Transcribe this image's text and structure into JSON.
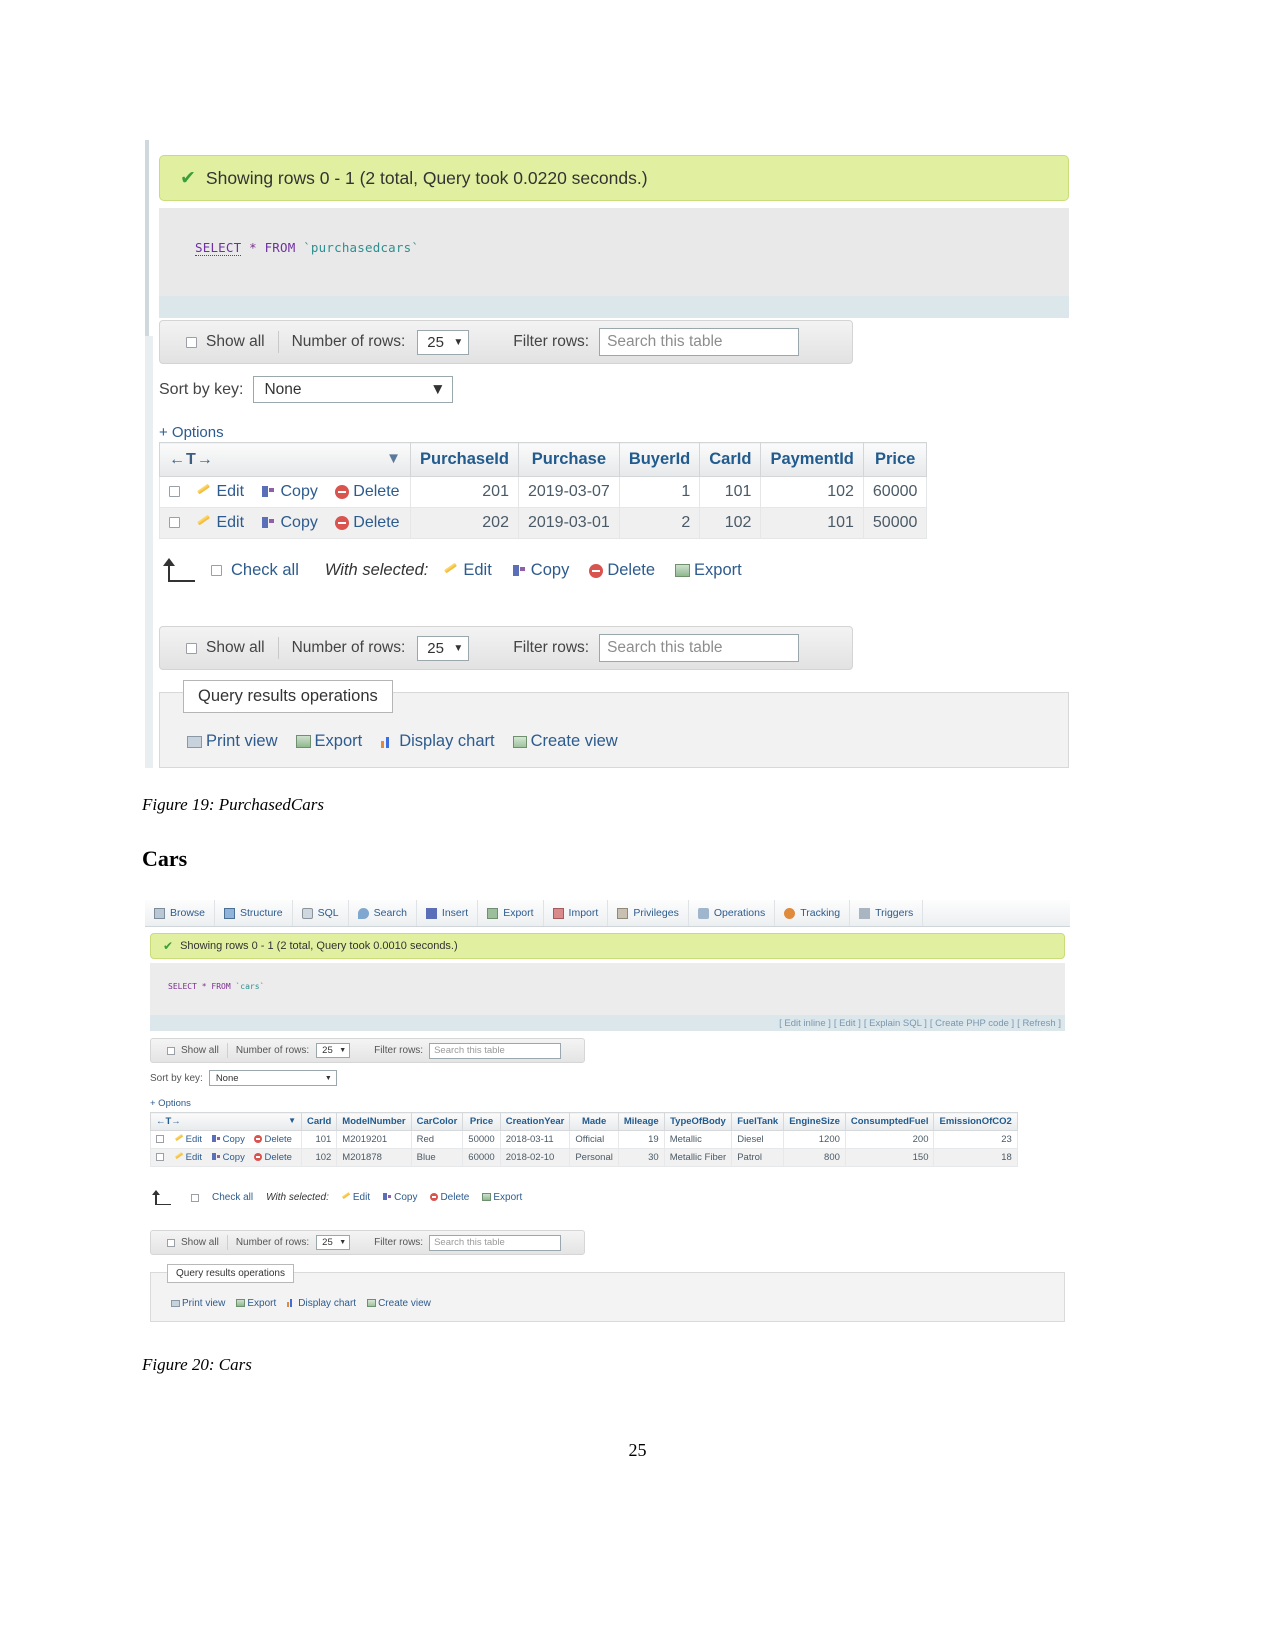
{
  "document": {
    "page_number": "25",
    "heading_cars": "Cars",
    "figure19_caption": "Figure 19: PurchasedCars",
    "figure20_caption": "Figure 20: Cars"
  },
  "figure19": {
    "status_message": "Showing rows 0 - 1 (2 total, Query took 0.0220 seconds.)",
    "sql": {
      "keyword": "SELECT",
      "star": "*",
      "from": "FROM",
      "table": "`purchasedcars`"
    },
    "toolbar": {
      "show_all": "Show all",
      "number_of_rows_label": "Number of rows:",
      "number_of_rows_value": "25",
      "filter_rows_label": "Filter rows:",
      "filter_placeholder": "Search this table"
    },
    "sort_by_key_label": "Sort by key:",
    "sort_by_key_value": "None",
    "options_link": "+ Options",
    "sort_glyph": "←T→",
    "row_actions": {
      "edit": "Edit",
      "copy": "Copy",
      "delete": "Delete"
    },
    "columns": [
      "PurchaseId",
      "Purchase",
      "BuyerId",
      "CarId",
      "PaymentId",
      "Price"
    ],
    "rows": [
      {
        "PurchaseId": "201",
        "Purchase": "2019-03-07",
        "BuyerId": "1",
        "CarId": "101",
        "PaymentId": "102",
        "Price": "60000"
      },
      {
        "PurchaseId": "202",
        "Purchase": "2019-03-01",
        "BuyerId": "2",
        "CarId": "102",
        "PaymentId": "101",
        "Price": "50000"
      }
    ],
    "with_selected": {
      "check_all": "Check all",
      "label": "With selected:",
      "edit": "Edit",
      "copy": "Copy",
      "delete": "Delete",
      "export": "Export"
    },
    "query_results_operations": {
      "title": "Query results operations",
      "print_view": "Print view",
      "export": "Export",
      "display_chart": "Display chart",
      "create_view": "Create view"
    }
  },
  "figure20": {
    "tabs": [
      {
        "label": "Browse",
        "icon": "browse-icon"
      },
      {
        "label": "Structure",
        "icon": "structure-icon"
      },
      {
        "label": "SQL",
        "icon": "sql-icon"
      },
      {
        "label": "Search",
        "icon": "search-icon"
      },
      {
        "label": "Insert",
        "icon": "insert-icon"
      },
      {
        "label": "Export",
        "icon": "export-icon"
      },
      {
        "label": "Import",
        "icon": "import-icon"
      },
      {
        "label": "Privileges",
        "icon": "privileges-icon"
      },
      {
        "label": "Operations",
        "icon": "operations-icon"
      },
      {
        "label": "Tracking",
        "icon": "tracking-icon"
      },
      {
        "label": "Triggers",
        "icon": "triggers-icon"
      }
    ],
    "status_message": "Showing rows 0 - 1 (2 total, Query took 0.0010 seconds.)",
    "sql": {
      "keyword": "SELECT",
      "star": "*",
      "from": "FROM",
      "table": "`cars`"
    },
    "sql_links": [
      "[ Edit inline ]",
      "[ Edit ]",
      "[ Explain SQL ]",
      "[ Create PHP code ]",
      "[ Refresh ]"
    ],
    "toolbar": {
      "show_all": "Show all",
      "number_of_rows_label": "Number of rows:",
      "number_of_rows_value": "25",
      "filter_rows_label": "Filter rows:",
      "filter_placeholder": "Search this table"
    },
    "sort_by_key_label": "Sort by key:",
    "sort_by_key_value": "None",
    "options_link": "+ Options",
    "sort_glyph": "←T→",
    "row_actions": {
      "edit": "Edit",
      "copy": "Copy",
      "delete": "Delete"
    },
    "columns": [
      "CarId",
      "ModelNumber",
      "CarColor",
      "Price",
      "CreationYear",
      "Made",
      "Mileage",
      "TypeOfBody",
      "FuelTank",
      "EngineSize",
      "ConsumptedFuel",
      "EmissionOfCO2"
    ],
    "rows": [
      {
        "CarId": "101",
        "ModelNumber": "M2019201",
        "CarColor": "Red",
        "Price": "50000",
        "CreationYear": "2018-03-11",
        "Made": "Official",
        "Mileage": "19",
        "TypeOfBody": "Metallic",
        "FuelTank": "Diesel",
        "EngineSize": "1200",
        "ConsumptedFuel": "200",
        "EmissionOfCO2": "23"
      },
      {
        "CarId": "102",
        "ModelNumber": "M201878",
        "CarColor": "Blue",
        "Price": "60000",
        "CreationYear": "2018-02-10",
        "Made": "Personal",
        "Mileage": "30",
        "TypeOfBody": "Metallic Fiber",
        "FuelTank": "Patrol",
        "EngineSize": "800",
        "ConsumptedFuel": "150",
        "EmissionOfCO2": "18"
      }
    ],
    "with_selected": {
      "check_all": "Check all",
      "label": "With selected:",
      "edit": "Edit",
      "copy": "Copy",
      "delete": "Delete",
      "export": "Export"
    },
    "query_results_operations": {
      "title": "Query results operations",
      "print_view": "Print view",
      "export": "Export",
      "display_chart": "Display chart",
      "create_view": "Create view"
    }
  }
}
